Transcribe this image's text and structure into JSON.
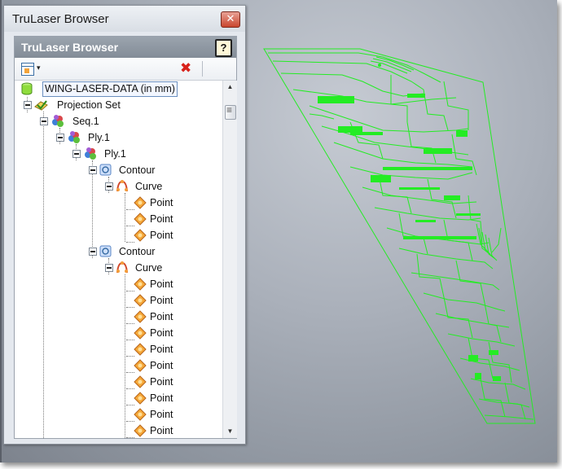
{
  "window": {
    "title": "TruLaser Browser",
    "close_glyph": "✕"
  },
  "panel": {
    "title": "TruLaser Browser",
    "help_glyph": "?"
  },
  "toolbar": {
    "view_icon": "view-options-icon",
    "caret": "▾",
    "delete_glyph": "✖"
  },
  "tree": {
    "root": "WING-LASER-DATA (in mm)",
    "projection_set": "Projection Set",
    "seq": "Seq.1",
    "ply_outer": "Ply.1",
    "ply_inner": "Ply.1",
    "contour1": "Contour",
    "curve1": "Curve",
    "points1": [
      "Point",
      "Point",
      "Point"
    ],
    "contour2": "Contour",
    "curve2": "Curve",
    "points2": [
      "Point",
      "Point",
      "Point",
      "Point",
      "Point",
      "Point",
      "Point",
      "Point",
      "Point",
      "Point"
    ]
  },
  "viewport": {
    "wireframe_color": "#22ee22",
    "background_color": "#a9afb9"
  }
}
